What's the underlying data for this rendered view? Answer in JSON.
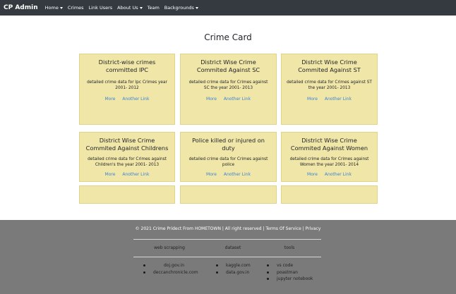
{
  "navbar": {
    "brand": "CP Admin",
    "items": [
      {
        "label": "Home",
        "dropdown": true
      },
      {
        "label": "Crimes",
        "dropdown": false
      },
      {
        "label": "Link Users",
        "dropdown": false
      },
      {
        "label": "About Us",
        "dropdown": true
      },
      {
        "label": "Team",
        "dropdown": false
      },
      {
        "label": "Backgrounds",
        "dropdown": true
      }
    ]
  },
  "main": {
    "title": "Crime Card",
    "cards": [
      {
        "title": "District-wise crimes committed IPC",
        "text": "detailed crime data for Ipc Crimes year 2001- 2012",
        "link1": "More",
        "link2": "Another Link"
      },
      {
        "title": "District Wise Crime Commited Against SC",
        "text": "detailed crime data for Crimes against SC the year 2001- 2013",
        "link1": "More",
        "link2": "Another Link"
      },
      {
        "title": "District Wise Crime Commited Against ST",
        "text": "detailed crime data for Crimes against ST the year 2001- 2013",
        "link1": "More",
        "link2": "Another Link"
      },
      {
        "title": "District Wise Crime Commited Against Childrens",
        "text": "detailed crime data for Crimes against Children's the year 2001- 2013",
        "link1": "More",
        "link2": "Another Link"
      },
      {
        "title": "Police killed or injured on duty",
        "text": "detailed crime data for Crimes against police",
        "link1": "More",
        "link2": "Another Link"
      },
      {
        "title": "District Wise Crime Commited Against Women",
        "text": "detailed crime data for Crimes against Women the year 2001- 2014",
        "link1": "More",
        "link2": "Another Link"
      }
    ]
  },
  "footer": {
    "copyright": "© 2021 Crime Pridect From HOMETOWN | All right reserved | Terms Of Service | Privacy",
    "columns": [
      {
        "heading": "web scrapping",
        "items": [
          "doj.gov.in",
          "deccanchronicle.com"
        ]
      },
      {
        "heading": "dataset",
        "items": [
          "kaggle.com",
          "data.gov.in"
        ]
      },
      {
        "heading": "tools",
        "items": [
          "vs code",
          "poastman",
          "jupyter notebook"
        ]
      }
    ]
  },
  "colors": {
    "navbar_bg": "#343a40",
    "card_bg": "#f0e6a8",
    "link": "#3b82d6",
    "footer_bg": "#7a7a7a"
  }
}
